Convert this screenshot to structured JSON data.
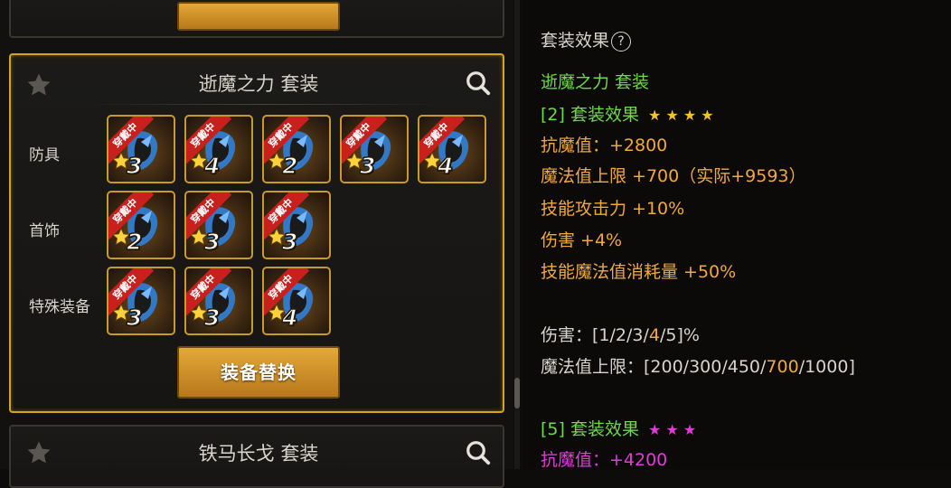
{
  "left": {
    "top_button_label": "",
    "main_set": {
      "title": "逝魔之力  套装",
      "rows": [
        {
          "label": "防具",
          "items": [
            {
              "badge": "穿戴中",
              "count": "3",
              "color": "#2f7fd8"
            },
            {
              "badge": "穿戴中",
              "count": "4",
              "color": "#2f7fd8"
            },
            {
              "badge": "穿戴中",
              "count": "2",
              "color": "#2f7fd8"
            },
            {
              "badge": "穿戴中",
              "count": "3",
              "color": "#2f7fd8"
            },
            {
              "badge": "穿戴中",
              "count": "4",
              "color": "#2f7fd8"
            }
          ]
        },
        {
          "label": "首饰",
          "items": [
            {
              "badge": "穿戴中",
              "count": "2",
              "color": "#2f7fd8"
            },
            {
              "badge": "穿戴中",
              "count": "3",
              "color": "#2f7fd8"
            },
            {
              "badge": "穿戴中",
              "count": "3",
              "color": "#2f7fd8"
            }
          ]
        },
        {
          "label": "特殊装备",
          "items": [
            {
              "badge": "穿戴中",
              "count": "3",
              "color": "#2f7fd8"
            },
            {
              "badge": "穿戴中",
              "count": "3",
              "color": "#2f7fd8"
            },
            {
              "badge": "穿戴中",
              "count": "4",
              "color": "#2f7fd8"
            }
          ]
        }
      ],
      "replace_button": "装备替换"
    },
    "bottom_set": {
      "title": "铁马长戈  套装"
    }
  },
  "right": {
    "header": "套装效果",
    "help_icon": "?",
    "set_name": "逝魔之力  套装",
    "tier2": {
      "title": "[2] 套装效果",
      "stars": "★ ★ ★ ★",
      "lines": [
        "抗魔值：+2800",
        "魔法值上限 +700（实际+9593）",
        "技能攻击力 +10%",
        "伤害 +4%",
        "技能魔法值消耗量 +50%"
      ]
    },
    "scaling": {
      "damage_prefix": "伤害：[1/2/3/",
      "damage_highlight": "4",
      "damage_suffix": "/5]%",
      "mp_prefix": "魔法值上限：[200/300/450/",
      "mp_highlight": "700",
      "mp_suffix": "/1000]"
    },
    "tier5": {
      "title": "[5] 套装效果",
      "stars": "★ ★ ★",
      "first_line": "抗魔值：+4200"
    }
  },
  "colors": {
    "accent_gold": "#d7a21c",
    "effect_green": "#6ed846",
    "stat_orange": "#f2a83a",
    "tier5_magenta": "#e03ad8"
  }
}
